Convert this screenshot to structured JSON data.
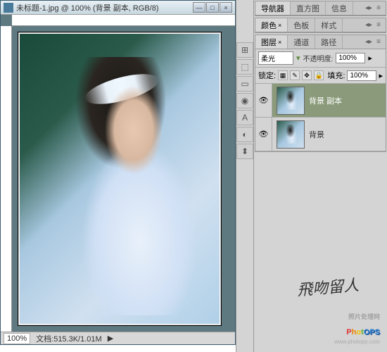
{
  "window": {
    "title": "未标题-1.jpg @ 100% (背景 副本, RGB/8)",
    "min": "—",
    "max": "□",
    "close": "×"
  },
  "status": {
    "zoom": "100%",
    "docsize": "文档:515.3K/1.01M"
  },
  "nav_panel": {
    "tabs": [
      "导航器",
      "直方图",
      "信息"
    ]
  },
  "color_panel": {
    "tabs": [
      "颜色",
      "色板",
      "样式"
    ],
    "close_x": "×"
  },
  "layers_panel": {
    "tabs": [
      "图层",
      "通道",
      "路径"
    ],
    "close_x": "×",
    "blend_mode": "柔光",
    "opacity_label": "不透明度:",
    "opacity_value": "100%",
    "lock_label": "锁定:",
    "fill_label": "填充:",
    "fill_value": "100%",
    "layers": [
      {
        "name": "背景 副本",
        "visible": true,
        "selected": true
      },
      {
        "name": "背景",
        "visible": true,
        "selected": false
      }
    ]
  },
  "vtools": [
    "⊞",
    "⬚",
    "▭",
    "◉",
    "A",
    "◐",
    "⬍"
  ],
  "watermark": {
    "calligraphy": "飛吻留人",
    "subtitle": "照片处理网",
    "url": "www.photops.com"
  }
}
